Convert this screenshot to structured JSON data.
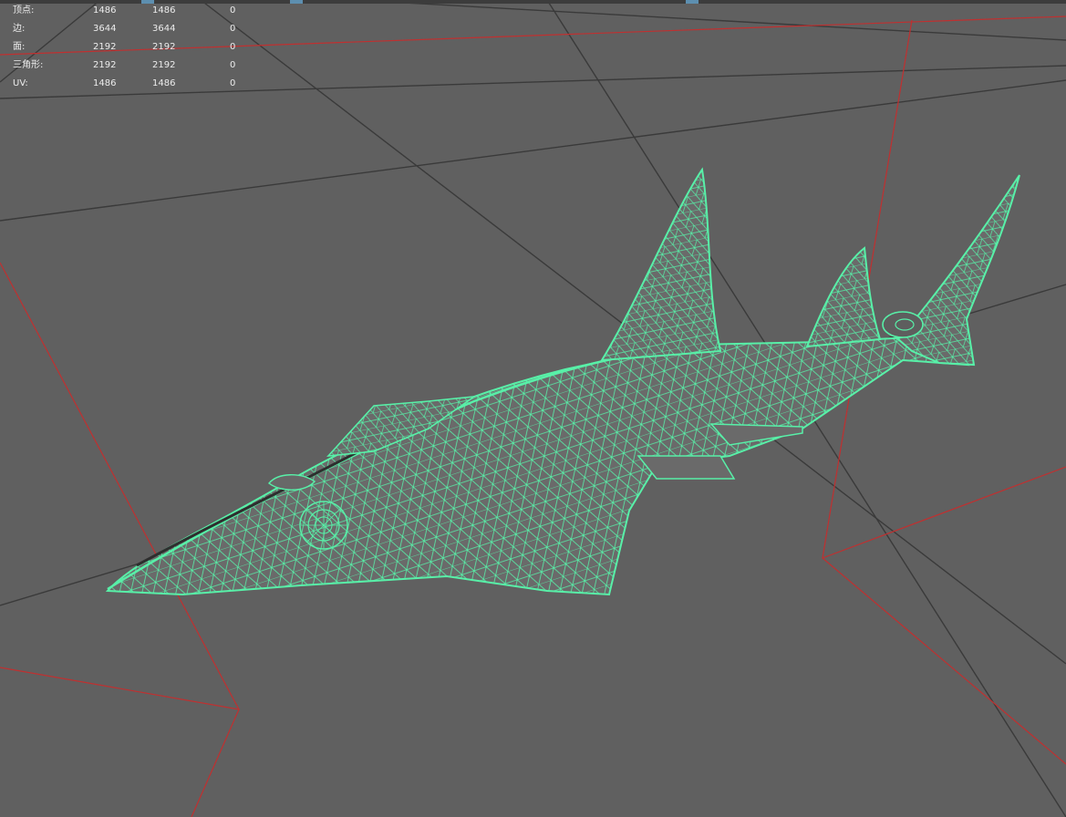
{
  "viewport": {
    "background_color": "#606060",
    "grid_color": "#3a3a3a",
    "camera_frustum_color": "#c03030",
    "wireframe_color": "#58f0a8"
  },
  "hud": {
    "rows": [
      {
        "label": "顶点:",
        "v1": "1486",
        "v2": "1486",
        "v3": "0"
      },
      {
        "label": "边:",
        "v1": "3644",
        "v2": "3644",
        "v3": "0"
      },
      {
        "label": "面:",
        "v1": "2192",
        "v2": "2192",
        "v3": "0"
      },
      {
        "label": "三角形:",
        "v1": "2192",
        "v2": "2192",
        "v3": "0"
      },
      {
        "label": "UV:",
        "v1": "1486",
        "v2": "1486",
        "v3": "0"
      }
    ]
  },
  "model": {
    "icon": "sawfish-wireframe-icon"
  }
}
